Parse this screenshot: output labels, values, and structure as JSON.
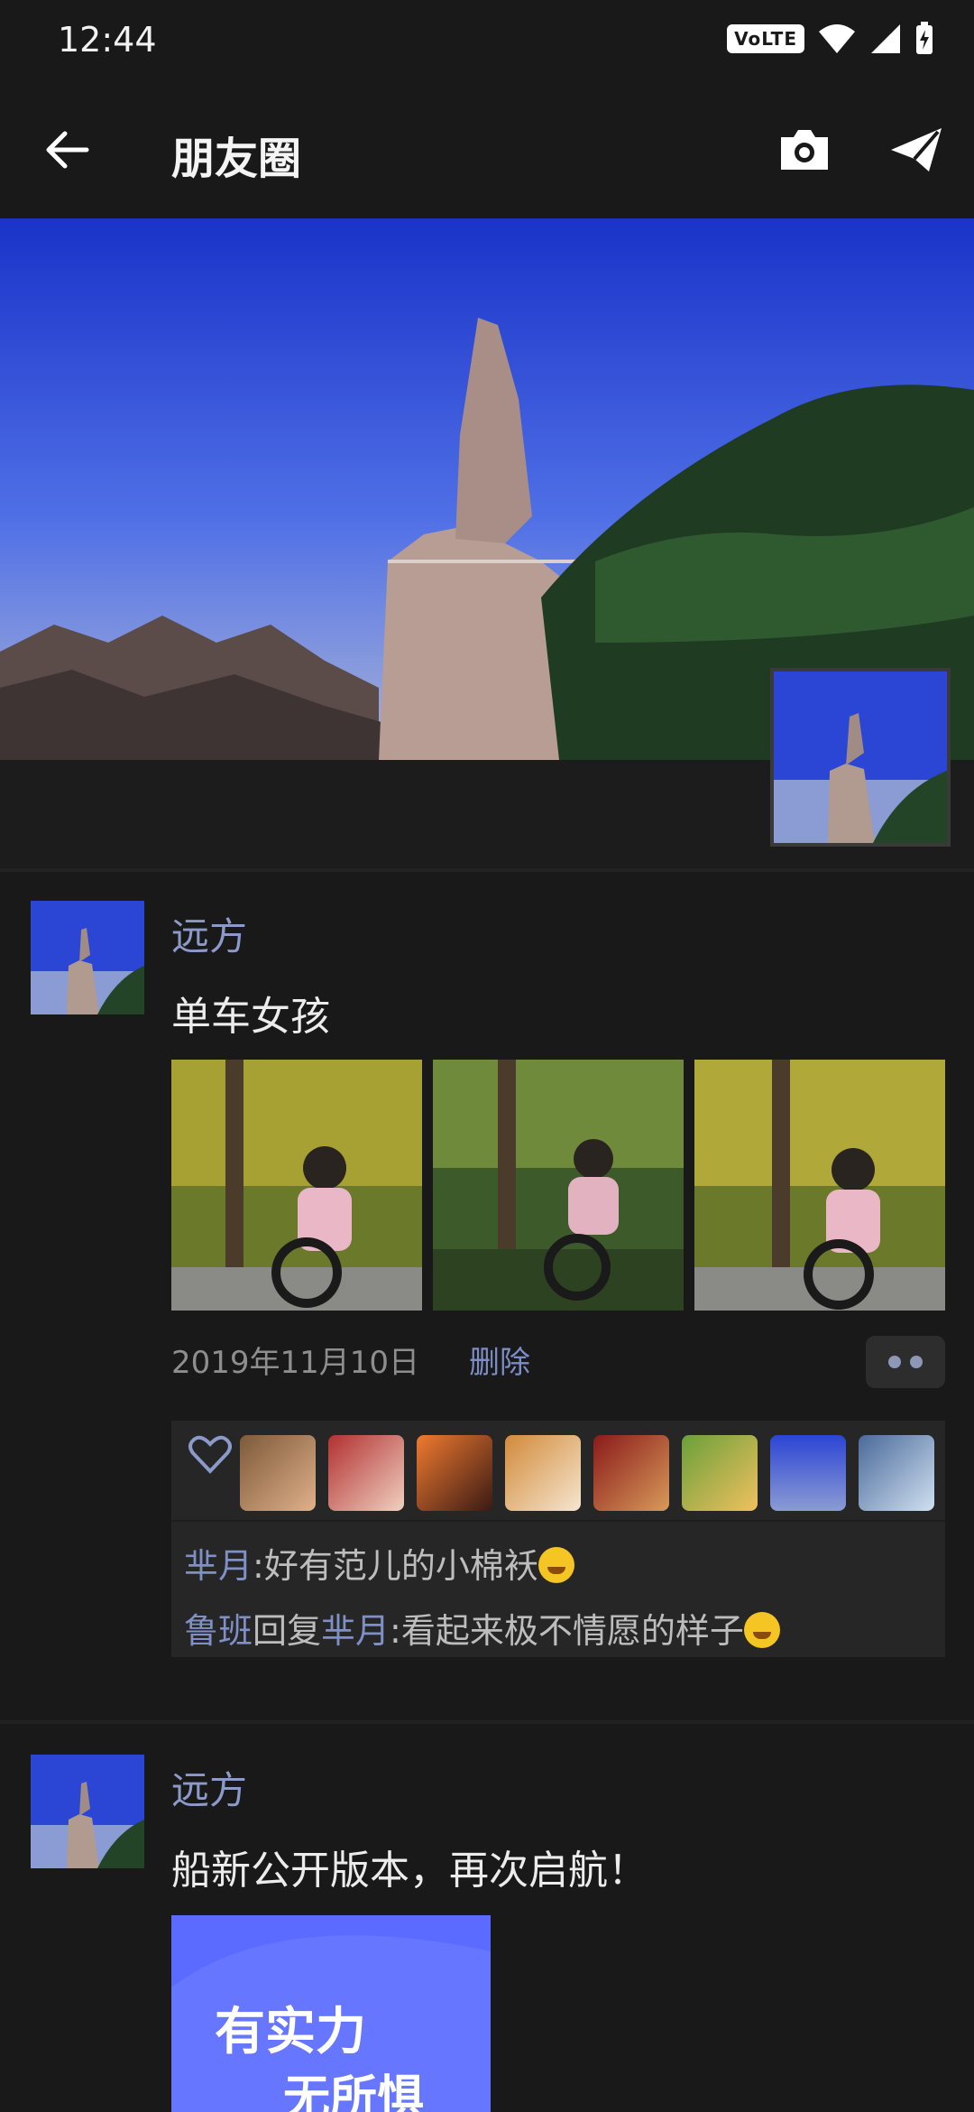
{
  "status_bar": {
    "time": "12:44",
    "volte": "VoLTE"
  },
  "header": {
    "title": "朋友圈"
  },
  "posts": [
    {
      "name": "远方",
      "text": "单车女孩",
      "date": "2019年11月10日",
      "delete_label": "删除",
      "likes_count": 8,
      "comments": [
        {
          "from": "芈月",
          "text": ":好有范儿的小棉袄"
        },
        {
          "from": "鲁班",
          "reply_word": "回复",
          "to": "芈月",
          "text": ":看起来极不情愿的样子"
        }
      ]
    },
    {
      "name": "远方",
      "text": "船新公开版本，再次启航！",
      "image_text_line1": "有实力",
      "image_text_line2": "无所惧"
    }
  ],
  "colors": {
    "background": "#191919",
    "name": "#8b9ac8",
    "accent": "#7b8dc4"
  }
}
